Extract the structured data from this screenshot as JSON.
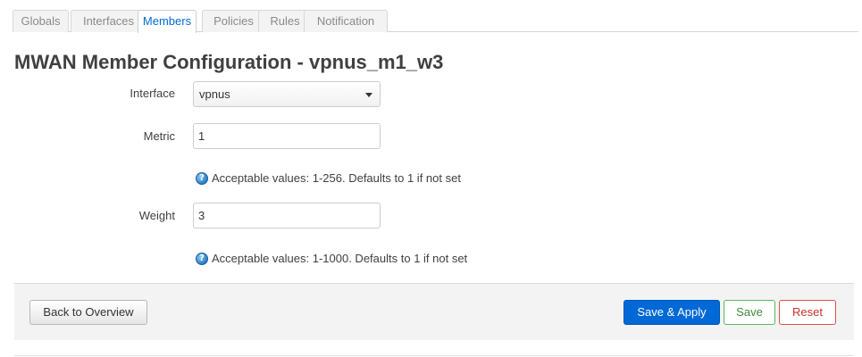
{
  "tabs": [
    {
      "label": "Globals",
      "active": false
    },
    {
      "label": "Interfaces",
      "active": false
    },
    {
      "label": "Members",
      "active": true
    },
    {
      "label": "Policies",
      "active": false
    },
    {
      "label": "Rules",
      "active": false
    },
    {
      "label": "Notification",
      "active": false
    }
  ],
  "page": {
    "title": "MWAN Member Configuration - vpnus_m1_w3"
  },
  "form": {
    "interface": {
      "label": "Interface",
      "value": "vpnus"
    },
    "metric": {
      "label": "Metric",
      "value": "1",
      "help": "Acceptable values: 1-256. Defaults to 1 if not set"
    },
    "weight": {
      "label": "Weight",
      "value": "3",
      "help": "Acceptable values: 1-1000. Defaults to 1 if not set"
    },
    "help_icon_glyph": "?"
  },
  "actions": {
    "back_label": "Back to Overview",
    "apply_label": "Save & Apply",
    "save_label": "Save",
    "reset_label": "Reset"
  },
  "icons": {
    "help": "help-question-icon",
    "select_caret": "caret-down-icon"
  },
  "colors": {
    "accent": "#0069d6",
    "save": "#5cb85c",
    "reset": "#d9534f"
  }
}
